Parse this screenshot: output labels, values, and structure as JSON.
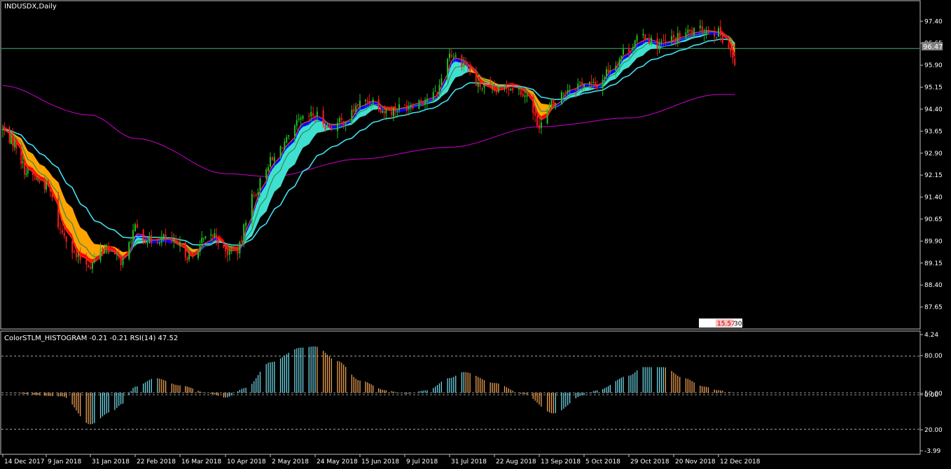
{
  "window": {
    "main_title": "INDUSDX,Daily",
    "indicator_title": "ColorSTLM_HISTOGRAM -0.21 -0.21 RSI(14) 47.52",
    "current_price_label": "96.47",
    "info_box_label": "15.57",
    "info_box_suffix": "30"
  },
  "colors": {
    "background": "#000000",
    "border": "#c0c0c0",
    "text": "#ffffff",
    "bull_candle": "#22c022",
    "bear_candle": "#ff1a1a",
    "band_up": "#40e0d0",
    "band_down": "#ffa500",
    "band_up_edge": "#0000ff",
    "band_down_edge": "#ff0000",
    "ma_fast": "#ff3030",
    "ma_mid": "#2e8b57",
    "ma_cyan": "#40e0f0",
    "ma_slow": "#cc00cc",
    "price_line": "#3cb371",
    "hist_up": "#6fd6e6",
    "hist_down": "#f0a050"
  },
  "chart_data": [
    {
      "type": "candlestick",
      "symbol": "INDUSDX",
      "timeframe": "Daily",
      "ylim": [
        86.9,
        98.1
      ],
      "y_ticks": [
        "97.40",
        "96.65",
        "95.90",
        "95.15",
        "94.40",
        "93.65",
        "92.90",
        "92.15",
        "91.40",
        "90.65",
        "89.90",
        "89.15",
        "88.40",
        "87.65"
      ],
      "x_ticks": [
        "14 Dec 2017",
        "9 Jan 2018",
        "31 Jan 2018",
        "22 Feb 2018",
        "16 Mar 2018",
        "10 Apr 2018",
        "2 May 2018",
        "24 May 2018",
        "15 Jun 2018",
        "9 Jul 2018",
        "31 Jul 2018",
        "22 Aug 2018",
        "13 Sep 2018",
        "5 Oct 2018",
        "29 Oct 2018",
        "20 Nov 2018",
        "12 Dec 2018"
      ],
      "current_price": 96.47,
      "price_path_anchors": [
        [
          "14 Dec 2017",
          93.7
        ],
        [
          "20 Dec 2017",
          93.3
        ],
        [
          "29 Dec 2017",
          92.2
        ],
        [
          "9 Jan 2018",
          91.8
        ],
        [
          "17 Jan 2018",
          90.2
        ],
        [
          "25 Jan 2018",
          89.3
        ],
        [
          "31 Jan 2018",
          89.1
        ],
        [
          "7 Feb 2018",
          89.7
        ],
        [
          "16 Feb 2018",
          89.2
        ],
        [
          "22 Feb 2018",
          90.3
        ],
        [
          "1 Mar 2018",
          89.9
        ],
        [
          "8 Mar 2018",
          90.0
        ],
        [
          "16 Mar 2018",
          89.7
        ],
        [
          "22 Mar 2018",
          89.3
        ],
        [
          "29 Mar 2018",
          89.9
        ],
        [
          "4 Apr 2018",
          90.1
        ],
        [
          "10 Apr 2018",
          89.5
        ],
        [
          "16 Apr 2018",
          89.6
        ],
        [
          "23 Apr 2018",
          91.4
        ],
        [
          "2 May 2018",
          92.6
        ],
        [
          "10 May 2018",
          93.3
        ],
        [
          "17 May 2018",
          94.0
        ],
        [
          "24 May 2018",
          94.2
        ],
        [
          "31 May 2018",
          93.8
        ],
        [
          "8 Jun 2018",
          94.0
        ],
        [
          "15 Jun 2018",
          94.6
        ],
        [
          "22 Jun 2018",
          94.7
        ],
        [
          "29 Jun 2018",
          94.3
        ],
        [
          "9 Jul 2018",
          94.5
        ],
        [
          "17 Jul 2018",
          94.7
        ],
        [
          "24 Jul 2018",
          94.9
        ],
        [
          "31 Jul 2018",
          96.3
        ],
        [
          "7 Aug 2018",
          96.0
        ],
        [
          "14 Aug 2018",
          95.2
        ],
        [
          "22 Aug 2018",
          95.0
        ],
        [
          "29 Aug 2018",
          95.2
        ],
        [
          "5 Sep 2018",
          95.0
        ],
        [
          "13 Sep 2018",
          93.9
        ],
        [
          "20 Sep 2018",
          94.6
        ],
        [
          "27 Sep 2018",
          95.1
        ],
        [
          "5 Oct 2018",
          95.3
        ],
        [
          "12 Oct 2018",
          95.2
        ],
        [
          "19 Oct 2018",
          95.8
        ],
        [
          "29 Oct 2018",
          96.5
        ],
        [
          "5 Nov 2018",
          96.9
        ],
        [
          "12 Nov 2018",
          96.6
        ],
        [
          "20 Nov 2018",
          96.8
        ],
        [
          "27 Nov 2018",
          97.0
        ],
        [
          "5 Dec 2018",
          97.1
        ],
        [
          "12 Dec 2018",
          97.0
        ],
        [
          "17 Dec 2018",
          96.5
        ],
        [
          "20 Dec 2018",
          95.9
        ]
      ],
      "slow_ma_anchors": [
        [
          "14 Dec 2017",
          95.2
        ],
        [
          "31 Jan 2018",
          94.2
        ],
        [
          "22 Feb 2018",
          93.4
        ],
        [
          "10 Apr 2018",
          92.2
        ],
        [
          "2 May 2018",
          92.1
        ],
        [
          "15 Jun 2018",
          92.7
        ],
        [
          "31 Jul 2018",
          93.1
        ],
        [
          "13 Sep 2018",
          93.8
        ],
        [
          "29 Oct 2018",
          94.1
        ],
        [
          "12 Dec 2018",
          94.9
        ]
      ]
    },
    {
      "type": "histogram",
      "name": "ColorSTLM_HISTOGRAM",
      "values_label": "-0.21 -0.21",
      "rsi_label": "RSI(14) 47.52",
      "ylim": [
        -3.99,
        4.24
      ],
      "y_ticks": [
        "4.24",
        "80.00",
        "50.00",
        "0.00",
        "20.00",
        "-3.99"
      ],
      "levels": [
        80,
        50,
        20
      ],
      "rsi_anchors": [
        [
          "14 Dec 2017",
          50
        ],
        [
          "17 Jan 2018",
          47
        ],
        [
          "31 Jan 2018",
          24
        ],
        [
          "10 Feb 2018",
          34
        ],
        [
          "16 Feb 2018",
          41
        ],
        [
          "22 Feb 2018",
          55
        ],
        [
          "4 Mar 2018",
          62
        ],
        [
          "16 Mar 2018",
          56
        ],
        [
          "2 Apr 2018",
          49
        ],
        [
          "10 Apr 2018",
          46
        ],
        [
          "20 Apr 2018",
          54
        ],
        [
          "2 May 2018",
          75
        ],
        [
          "17 May 2018",
          87
        ],
        [
          "24 May 2018",
          88
        ],
        [
          "4 Jun 2018",
          76
        ],
        [
          "15 Jun 2018",
          60
        ],
        [
          "29 Jun 2018",
          52
        ],
        [
          "9 Jul 2018",
          49
        ],
        [
          "20 Jul 2018",
          52
        ],
        [
          "31 Jul 2018",
          62
        ],
        [
          "7 Aug 2018",
          67
        ],
        [
          "22 Aug 2018",
          58
        ],
        [
          "5 Sep 2018",
          49
        ],
        [
          "20 Sep 2018",
          33
        ],
        [
          "5 Oct 2018",
          48
        ],
        [
          "12 Oct 2018",
          52
        ],
        [
          "29 Oct 2018",
          64
        ],
        [
          "5 Nov 2018",
          71
        ],
        [
          "15 Nov 2018",
          71
        ],
        [
          "25 Nov 2018",
          62
        ],
        [
          "5 Dec 2018",
          55
        ],
        [
          "12 Dec 2018",
          52
        ],
        [
          "20 Dec 2018",
          50
        ]
      ],
      "bar_colors": "light blue when the value rises, orange when it falls"
    }
  ]
}
